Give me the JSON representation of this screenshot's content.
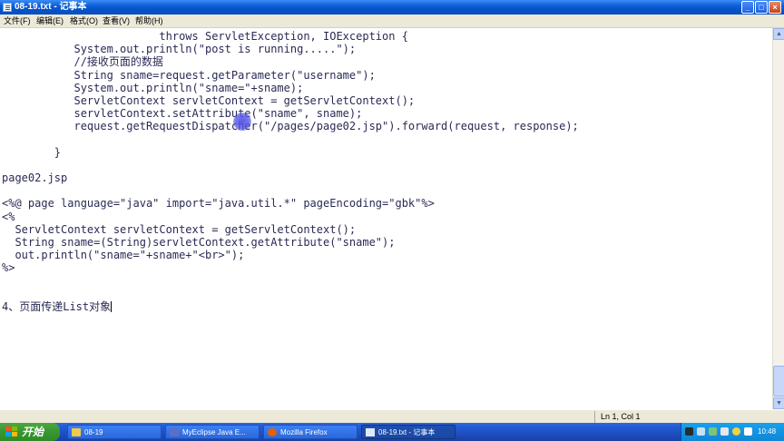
{
  "window": {
    "title": "08-19.txt - 记事本",
    "min_glyph": "_",
    "max_glyph": "□",
    "close_glyph": "×"
  },
  "menu": {
    "file": "文件(F)",
    "edit": "编辑(E)",
    "format": "格式(O)",
    "view": "查看(V)",
    "help": "帮助(H)"
  },
  "editor": {
    "lines": [
      "                        throws ServletException, IOException {",
      "           System.out.println(\"post is running.....\");",
      "           //接收页面的数据",
      "           String sname=request.getParameter(\"username\");",
      "           System.out.println(\"sname=\"+sname);",
      "           ServletContext servletContext = getServletContext();",
      "           servletContext.setAttribute(\"sname\", sname);",
      "           request.getRequestDispatcher(\"/pages/page02.jsp\").forward(request, response);",
      "",
      "        }",
      "",
      "page02.jsp",
      "",
      "<%@ page language=\"java\" import=\"java.util.*\" pageEncoding=\"gbk\"%>",
      "<%",
      "  ServletContext servletContext = getServletContext();",
      "  String sname=(String)servletContext.getAttribute(\"sname\");",
      "  out.println(\"sname=\"+sname+\"<br>\");",
      "%>",
      "",
      "",
      "4、页面传递List对象"
    ]
  },
  "statusbar": {
    "position": "Ln 1, Col 1"
  },
  "taskbar": {
    "start_label": "开始",
    "tasks": [
      {
        "label": "08-19"
      },
      {
        "label": "MyEclipse Java E..."
      },
      {
        "label": "Mozilla Firefox"
      },
      {
        "label": "08-19.txt - 记事本"
      }
    ],
    "clock": "10:48"
  },
  "colors": {
    "titlebar": "#0a5fd8",
    "code_text": "#2a2a55",
    "cursor_highlight": "#5050e6",
    "start_button": "#3a9a32",
    "tray": "#0f86d6"
  }
}
